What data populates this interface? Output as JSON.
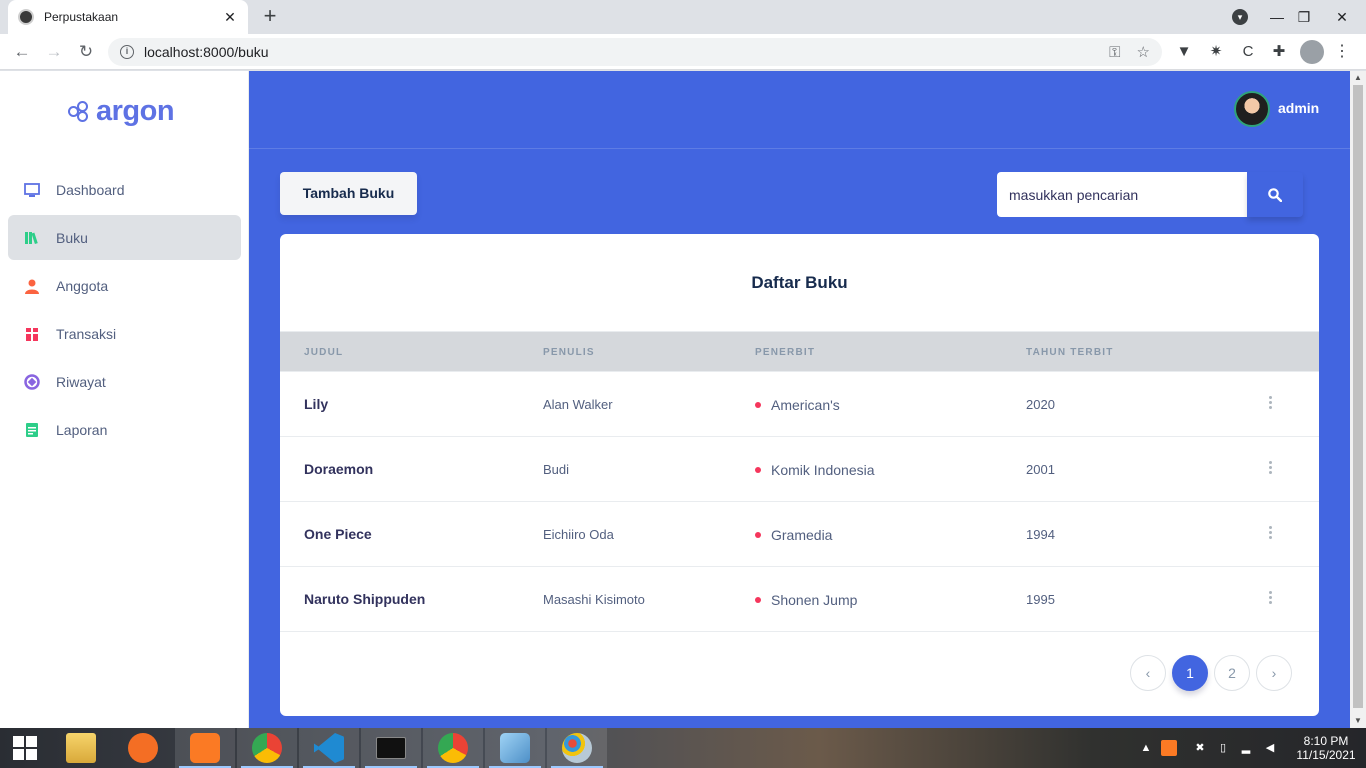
{
  "browser": {
    "tab_title": "Perpustakaan",
    "tab_close": "✕",
    "new_tab": "+",
    "url": "localhost:8000/buku"
  },
  "app": {
    "brand": "argon",
    "user": "admin",
    "accent_color": "#4265e0",
    "sidebar": {
      "items": [
        {
          "label": "Dashboard",
          "icon": "monitor-icon",
          "color": "#5e72e4"
        },
        {
          "label": "Buku",
          "icon": "books-icon",
          "color": "#2dce89",
          "active": true
        },
        {
          "label": "Anggota",
          "icon": "user-icon",
          "color": "#fb6340"
        },
        {
          "label": "Transaksi",
          "icon": "transaction-icon",
          "color": "#f5365c"
        },
        {
          "label": "Riwayat",
          "icon": "history-icon",
          "color": "#8965e0"
        },
        {
          "label": "Laporan",
          "icon": "report-icon",
          "color": "#2dce89"
        }
      ]
    },
    "add_button": "Tambah Buku",
    "search": {
      "placeholder": "masukkan pencarian"
    },
    "table": {
      "title": "Daftar Buku",
      "columns": [
        "Judul",
        "Penulis",
        "Penerbit",
        "Tahun Terbit"
      ],
      "rows": [
        {
          "judul": "Lily",
          "penulis": "Alan Walker",
          "penerbit": "American's",
          "tahun": "2020"
        },
        {
          "judul": "Doraemon",
          "penulis": "Budi",
          "penerbit": "Komik Indonesia",
          "tahun": "2001"
        },
        {
          "judul": "One Piece",
          "penulis": "Eichiiro Oda",
          "penerbit": "Gramedia",
          "tahun": "1994"
        },
        {
          "judul": "Naruto Shippuden",
          "penulis": "Masashi Kisimoto",
          "penerbit": "Shonen Jump",
          "tahun": "1995"
        }
      ]
    },
    "pagination": {
      "prev": "‹",
      "pages": [
        "1",
        "2"
      ],
      "current": "1",
      "next": "›"
    }
  },
  "taskbar": {
    "time": "8:10 PM",
    "date": "11/15/2021",
    "apps": [
      "file-explorer-icon",
      "sublime-text-icon",
      "xampp-icon",
      "chrome-icon",
      "vscode-icon",
      "terminal-icon",
      "chrome-profile-icon",
      "notepad-icon",
      "paint-icon"
    ]
  }
}
